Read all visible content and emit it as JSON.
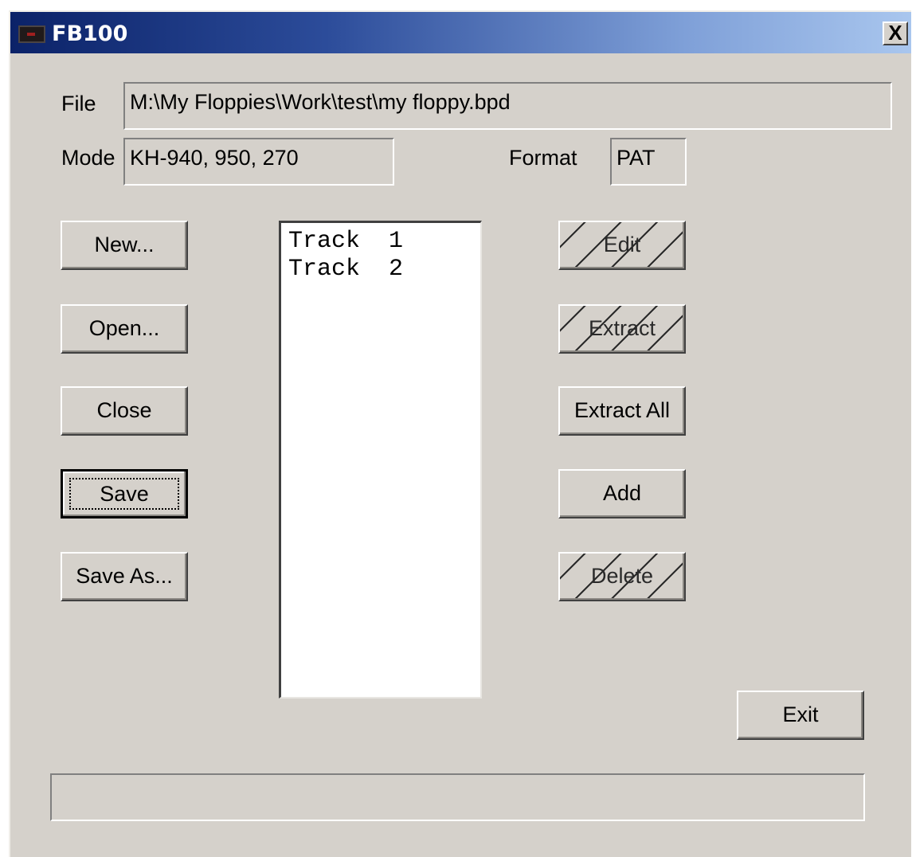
{
  "window": {
    "title": "FB100",
    "close_label": "X"
  },
  "file": {
    "label": "File",
    "value": "M:\\My Floppies\\Work\\test\\my floppy.bpd"
  },
  "mode": {
    "label": "Mode",
    "value": "KH-940, 950, 270"
  },
  "format": {
    "label": "Format",
    "value": "PAT"
  },
  "left_buttons": {
    "new": "New...",
    "open": "Open...",
    "close": "Close",
    "save": "Save",
    "save_as": "Save As..."
  },
  "tracks": [
    {
      "name": "Track",
      "number": "1"
    },
    {
      "name": "Track",
      "number": "2"
    }
  ],
  "right_buttons": {
    "edit": {
      "label": "Edit",
      "enabled": false
    },
    "extract": {
      "label": "Extract",
      "enabled": false
    },
    "extract_all": {
      "label": "Extract All",
      "enabled": true
    },
    "add": {
      "label": "Add",
      "enabled": true
    },
    "delete": {
      "label": "Delete",
      "enabled": false
    }
  },
  "exit": "Exit",
  "status_bar": ""
}
